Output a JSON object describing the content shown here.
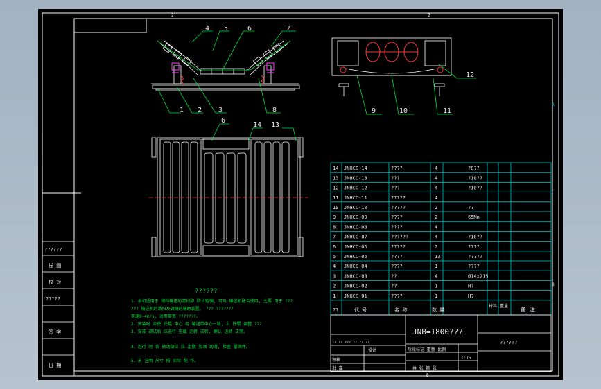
{
  "frame": {
    "zone_top": "2",
    "zone_bottom": "B",
    "zone_right_a": "A",
    "zone_right_b": "B",
    "zone_left_a": "A",
    "zone_left_b": "B"
  },
  "side_view": {
    "callouts_top": [
      "4",
      "5",
      "6",
      "7"
    ],
    "callouts_bottom": [
      "1",
      "2",
      "3",
      "8"
    ]
  },
  "end_view": {
    "callouts": [
      "12",
      "9",
      "10",
      "11"
    ]
  },
  "plan_view": {
    "callouts": [
      "6",
      "14",
      "13"
    ]
  },
  "notes": {
    "title": "??????",
    "lines": [
      "1、本机适用于 物料输送的清扫和 防止跑偏, 可与 输送机配合使用, 主要 用于 ???",
      "    ??? 输送机的清扫及调偏的辅助装置。 ??? ???????",
      "   带速0-4m/s, 适用带宽 ???????。",
      "2、安装时 应使 托辊 中心 与 输送带中心一致, 上 托辊 调整 ???",
      "3、安装 调试后 应进行 空载 运转 试验, 确认 运转 正常。",
      "4、运行 时 各 转动部位 应 定期 加油 润滑, 检查 紧固件。",
      "5、未 注明 尺寸 按 实际 配 作。"
    ]
  },
  "bom": {
    "rows": [
      {
        "no": "14",
        "code": "JNHCC-14",
        "name": "????",
        "qty": "4",
        "note": "?8??"
      },
      {
        "no": "13",
        "code": "JNHCC-13",
        "name": "???",
        "qty": "4",
        "note": "?10??"
      },
      {
        "no": "12",
        "code": "JNHCC-12",
        "name": "???",
        "qty": "4",
        "note": "?10??"
      },
      {
        "no": "11",
        "code": "JNHCC-11",
        "name": "?????",
        "qty": "4",
        "note": ""
      },
      {
        "no": "10",
        "code": "JNHCC-10",
        "name": "?????",
        "qty": "2",
        "note": "??"
      },
      {
        "no": "9",
        "code": "JNHCC-09",
        "name": "????",
        "qty": "2",
        "note": "65Mn"
      },
      {
        "no": "8",
        "code": "JNHCC-08",
        "name": "????",
        "qty": "4",
        "note": ""
      },
      {
        "no": "7",
        "code": "JNHCC-07",
        "name": "??????",
        "qty": "4",
        "note": "?10??"
      },
      {
        "no": "6",
        "code": "JNHCC-06",
        "name": "?????",
        "qty": "2",
        "note": "????"
      },
      {
        "no": "5",
        "code": "JNHCC-05",
        "name": "????",
        "qty": "13",
        "note": "?????"
      },
      {
        "no": "4",
        "code": "JNHCC-04",
        "name": "????",
        "qty": "1",
        "note": "????"
      },
      {
        "no": "3",
        "code": "JNHCC-03",
        "name": "??",
        "qty": "4",
        "note": "Ø14x215"
      },
      {
        "no": "2",
        "code": "JNHCC-02",
        "name": "??",
        "qty": "1",
        "note": "H?"
      },
      {
        "no": "1",
        "code": "JNHCC-01",
        "name": "????",
        "qty": "1",
        "note": "H?"
      }
    ],
    "header": {
      "no": "??",
      "code": "代 号",
      "name": "名 称",
      "qty": "数 量",
      "material": "材料",
      "weight": "重量",
      "note": "备 注"
    }
  },
  "title_block": {
    "drawing_name": "JNB=1800???",
    "company": "??????",
    "sign_rows": [
      "??  ??  ???  ??  ??  ??",
      "设计",
      "审核",
      "批 准"
    ],
    "scale": "1:15",
    "sheet": "共 张 第 张",
    "stage_label": "阶段标记  重量  比例"
  },
  "left_strip": {
    "labels": [
      "??????",
      "描 图",
      "校 对",
      "?????",
      "签 字",
      "日 期"
    ]
  }
}
